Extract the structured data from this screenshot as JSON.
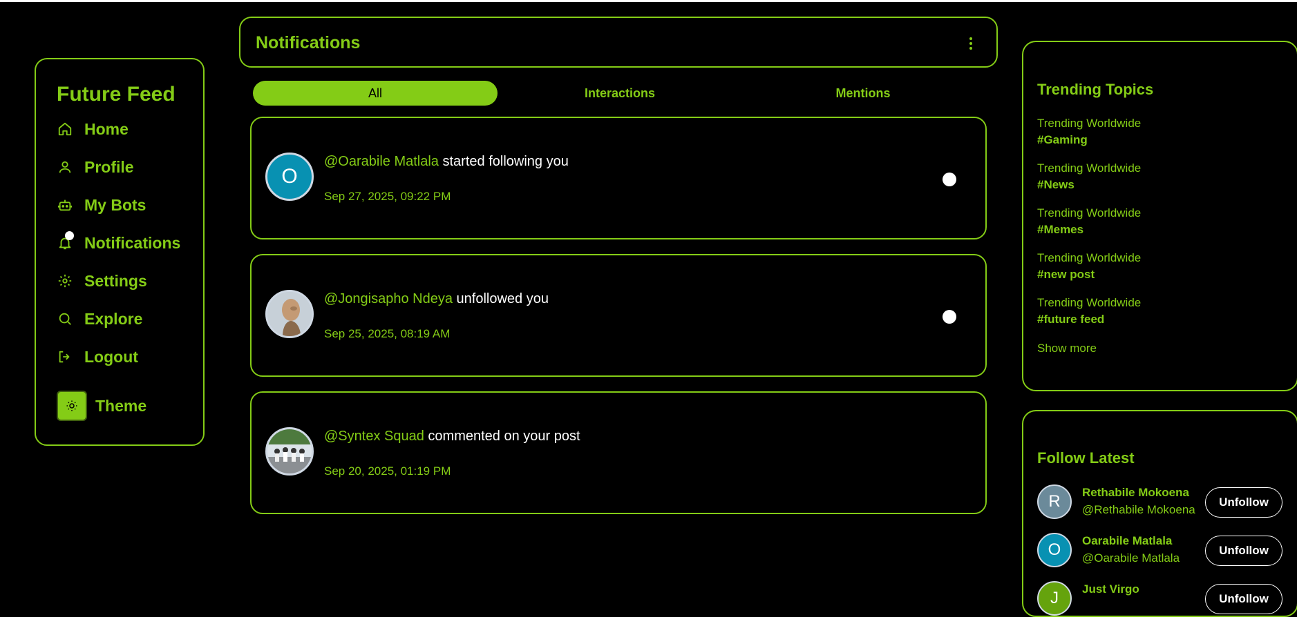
{
  "brand": "Future Feed",
  "sidebar": {
    "items": [
      {
        "label": "Home",
        "icon": "home-icon"
      },
      {
        "label": "Profile",
        "icon": "user-icon"
      },
      {
        "label": "My Bots",
        "icon": "bot-icon"
      },
      {
        "label": "Notifications",
        "icon": "bell-icon",
        "has_dot": true
      },
      {
        "label": "Settings",
        "icon": "gear-icon"
      },
      {
        "label": "Explore",
        "icon": "search-icon"
      },
      {
        "label": "Logout",
        "icon": "logout-icon"
      }
    ],
    "theme_label": "Theme"
  },
  "header": {
    "title": "Notifications"
  },
  "tabs": [
    {
      "label": "All",
      "active": true
    },
    {
      "label": "Interactions",
      "active": false
    },
    {
      "label": "Mentions",
      "active": false
    }
  ],
  "notifications": [
    {
      "user": "@Oarabile Matlala",
      "action": "started following you",
      "time": "Sep 27, 2025, 09:22 PM",
      "avatar_letter": "O",
      "unread": true
    },
    {
      "user": "@Jongisapho Ndeya",
      "action": "unfollowed you",
      "time": "Sep 25, 2025, 08:19 AM",
      "avatar_letter": "",
      "unread": true
    },
    {
      "user": "@Syntex Squad",
      "action": "commented on your post",
      "time": "Sep 20, 2025, 01:19 PM",
      "avatar_letter": "",
      "unread": false
    }
  ],
  "trending": {
    "title": "Trending Topics",
    "items": [
      {
        "sub": "Trending Worldwide",
        "tag": "#Gaming"
      },
      {
        "sub": "Trending Worldwide",
        "tag": "#News"
      },
      {
        "sub": "Trending Worldwide",
        "tag": "#Memes"
      },
      {
        "sub": "Trending Worldwide",
        "tag": "#new post"
      },
      {
        "sub": "Trending Worldwide",
        "tag": "#future feed"
      }
    ],
    "show_more": "Show more"
  },
  "follow": {
    "title": "Follow Latest",
    "users": [
      {
        "name": "Rethabile Mokoena",
        "handle": "@Rethabile Mokoena",
        "letter": "R",
        "button": "Unfollow"
      },
      {
        "name": "Oarabile Matlala",
        "handle": "@Oarabile Matlala",
        "letter": "O",
        "button": "Unfollow"
      },
      {
        "name": "Just Virgo",
        "handle": "",
        "letter": "J",
        "button": "Unfollow"
      }
    ]
  },
  "colors": {
    "accent": "#84cc16",
    "background": "#000000",
    "avatar_teal": "#0891b2",
    "avatar_gray": "#6b8a9a",
    "avatar_green": "#65a30d"
  }
}
